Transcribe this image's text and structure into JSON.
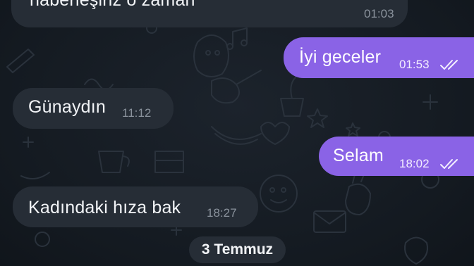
{
  "chat": {
    "messages": [
      {
        "text": "haberleşiriz o zaman",
        "time": "01:03",
        "direction": "incoming"
      },
      {
        "text": "İyi geceler",
        "time": "01:53",
        "direction": "outgoing",
        "status": "read"
      },
      {
        "text": "Günaydın",
        "time": "11:12",
        "direction": "incoming"
      },
      {
        "text": "Selam",
        "time": "18:02",
        "direction": "outgoing",
        "status": "read"
      },
      {
        "text": "Kadındaki hıza bak",
        "time": "18:27",
        "direction": "incoming"
      }
    ],
    "date_separator": "3 Temmuz"
  },
  "colors": {
    "background": "#151b22",
    "incoming_bubble": "#262d36",
    "outgoing_bubble": "#8a63e6"
  },
  "icons": {
    "read_receipt": "double-check-icon"
  }
}
